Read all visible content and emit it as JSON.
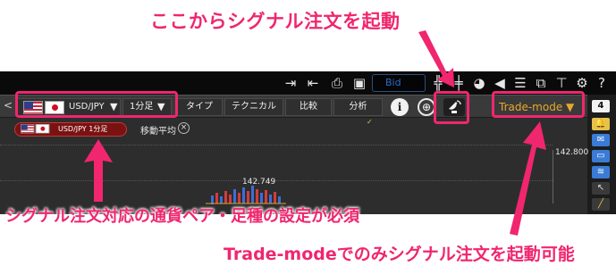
{
  "annotations": {
    "top": "ここからシグナル注文を起動",
    "middle": "シグナル注文対応の通貨ペア・足種の設定が必須",
    "bottom": "Trade-modeでのみシグナル注文を起動可能"
  },
  "colors": {
    "annotation": "#f0266e",
    "trade_mode": "#e8a82a",
    "bid": "#2e6cc7"
  },
  "topbar": {
    "bid_label": "Bid",
    "icons": [
      "export-icon",
      "import-icon",
      "print-icon",
      "save-icon",
      "cross-hair-split-icon",
      "cross-hair-merge-icon",
      "pie-chart-icon",
      "megaphone-icon",
      "list-icon",
      "line-chart-icon",
      "paint-roller-icon",
      "gear-icon",
      "question-icon"
    ]
  },
  "toolbar": {
    "back_chevron": "<",
    "symbol": "USD/JPY",
    "timeframe": "1分足",
    "type_label": "タイプ",
    "technical_label": "テクニカル",
    "compare_label": "比較",
    "analysis_label": "分析",
    "info_glyph": "i",
    "trade_mode_label": "Trade-mode ▼",
    "dropdown_glyph": "▼"
  },
  "right_bar": {
    "count": "4"
  },
  "chart": {
    "symbol_pill": "USD/JPY 1分足",
    "indicator_label": "移動平均",
    "close_glyph": "×",
    "price_axis_label": "142.800",
    "peak_label": "142.749"
  }
}
